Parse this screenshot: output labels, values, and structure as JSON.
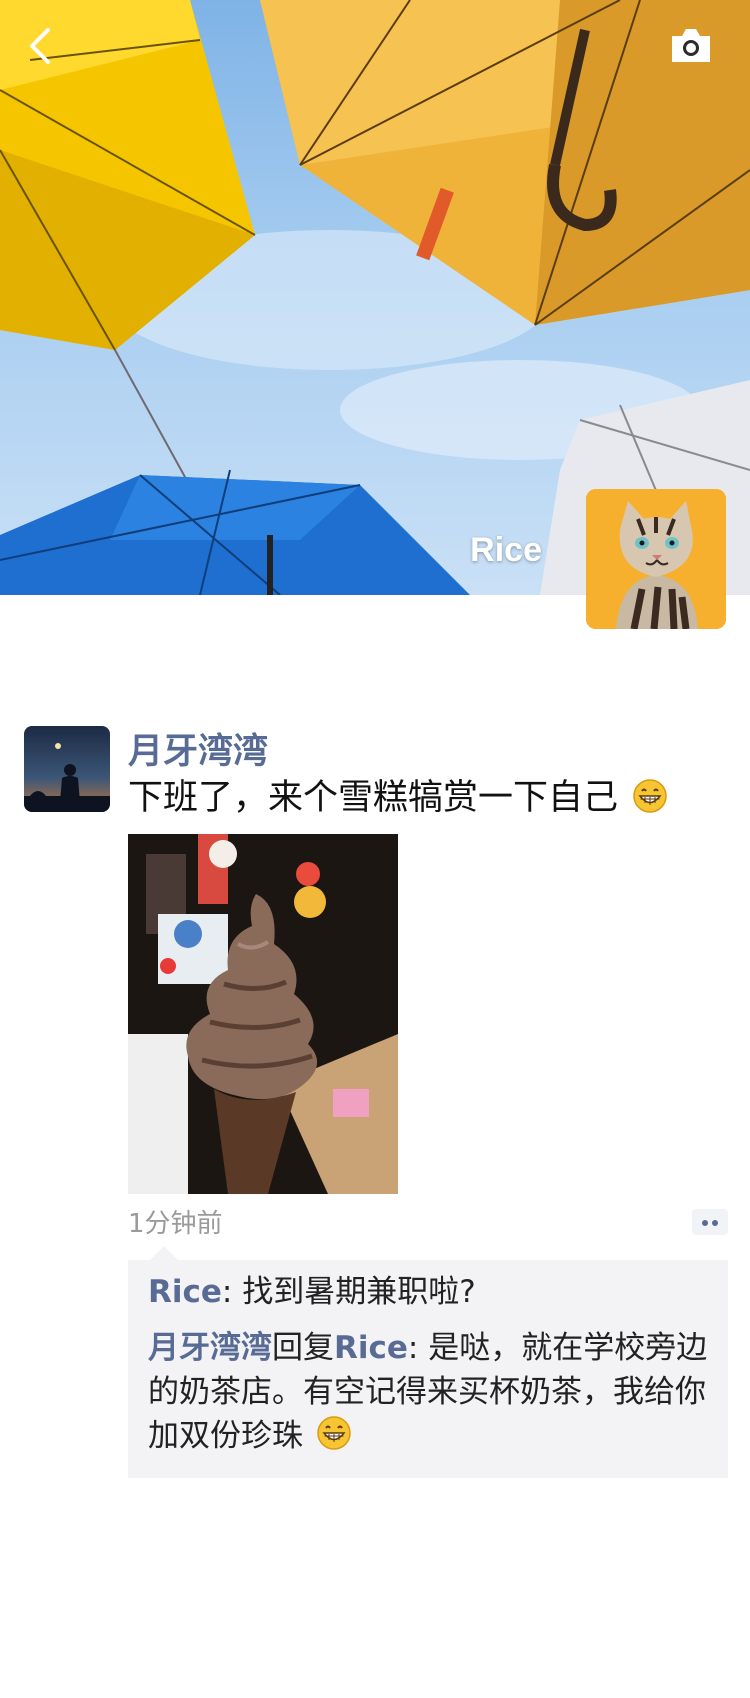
{
  "cover": {
    "profile_name": "Rice"
  },
  "icons": {
    "back": "chevron-left-icon",
    "camera": "camera-icon",
    "more": "more-dots-icon",
    "emoji": "grinning-face-emoji"
  },
  "post": {
    "author": "月牙湾湾",
    "text": "下班了，来个雪糕犒赏一下自己",
    "time": "1分钟前"
  },
  "comments": [
    {
      "author": "Rice",
      "separator": ": ",
      "text": "找到暑期兼职啦?"
    },
    {
      "author": "月牙湾湾",
      "reply_word": "回复",
      "reply_to": "Rice",
      "separator": ": ",
      "text": "是哒，就在学校旁边的奶茶店。有空记得来买杯奶茶，我给你加双份珍珠"
    }
  ],
  "colors": {
    "link_blue": "#576b95",
    "comment_bg": "#f3f3f5",
    "time_gray": "#9a9a9a"
  }
}
